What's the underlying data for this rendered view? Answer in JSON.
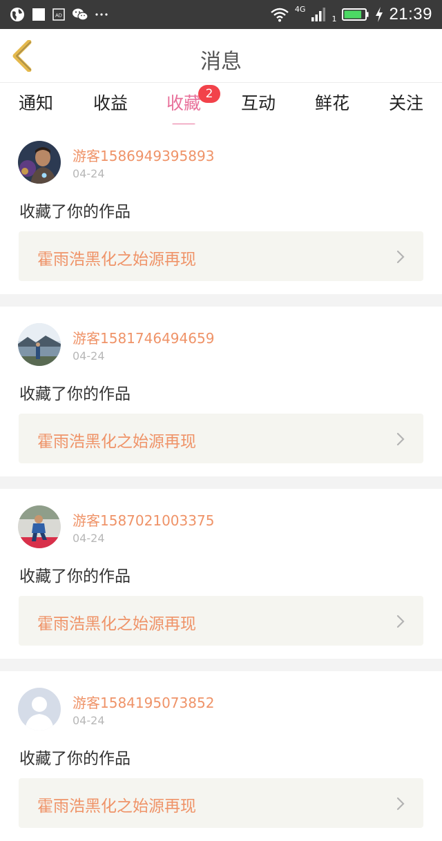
{
  "status_bar": {
    "time": "21:39",
    "network": "4G",
    "sim_slot": "1",
    "icons": [
      "globe-icon",
      "square-icon",
      "ad-icon",
      "wechat-icon",
      "more-dots-icon",
      "wifi-icon",
      "signal-icon",
      "battery-icon",
      "charging-icon"
    ],
    "battery_level": 0.85,
    "battery_color": "#4cd964"
  },
  "header": {
    "title": "消息",
    "back_icon": "back-chevron-icon",
    "back_color": "#e5b94c"
  },
  "tabs": [
    {
      "label": "通知",
      "active": false
    },
    {
      "label": "收益",
      "active": false
    },
    {
      "label": "收藏",
      "active": true,
      "badge": "2"
    },
    {
      "label": "互动",
      "active": false
    },
    {
      "label": "鲜花",
      "active": false
    },
    {
      "label": "关注",
      "active": false
    }
  ],
  "colors": {
    "accent": "#e8709a",
    "badge": "#f2424a",
    "username": "#ef9368",
    "date": "#b7b7b7",
    "work_box_bg": "#f5f5f0"
  },
  "notifications": [
    {
      "username": "游客1586949395893",
      "date": "04-24",
      "action": "收藏了你的作品",
      "work_title": "霍雨浩黑化之始源再现",
      "avatar": "avatar-superhero"
    },
    {
      "username": "游客1581746494659",
      "date": "04-24",
      "action": "收藏了你的作品",
      "work_title": "霍雨浩黑化之始源再现",
      "avatar": "avatar-lake"
    },
    {
      "username": "游客1587021003375",
      "date": "04-24",
      "action": "收藏了你的作品",
      "work_title": "霍雨浩黑化之始源再现",
      "avatar": "avatar-child"
    },
    {
      "username": "游客1584195073852",
      "date": "04-24",
      "action": "收藏了你的作品",
      "work_title": "霍雨浩黑化之始源再现",
      "avatar": "avatar-default"
    }
  ]
}
